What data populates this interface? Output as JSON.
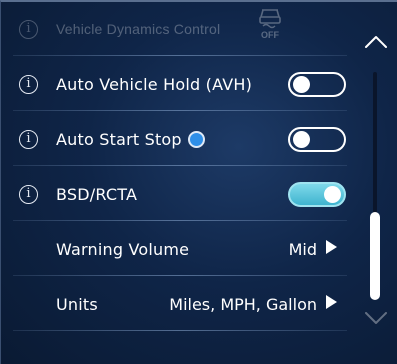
{
  "settings": {
    "rows": [
      {
        "label": "Vehicle Dynamics Control",
        "icon": "vdc-off-icon",
        "icon_text": "OFF",
        "disabled": true
      },
      {
        "label": "Auto Vehicle Hold (AVH)",
        "toggle": "off"
      },
      {
        "label": "Auto Start Stop",
        "status_dot": "blue",
        "toggle": "off"
      },
      {
        "label": "BSD/RCTA",
        "toggle": "on"
      },
      {
        "label": "Warning Volume",
        "value": "Mid"
      },
      {
        "label": "Units",
        "value": "Miles, MPH, Gallon"
      }
    ],
    "info_glyph": "i"
  },
  "colors": {
    "background": "#0f2548",
    "toggle_on": "#4fc3dc",
    "status_dot": "#2f8fe8"
  },
  "scrollbar": {
    "position_fraction": 0.85,
    "up_icon": "chevron-up-icon",
    "down_icon": "chevron-down-icon"
  }
}
